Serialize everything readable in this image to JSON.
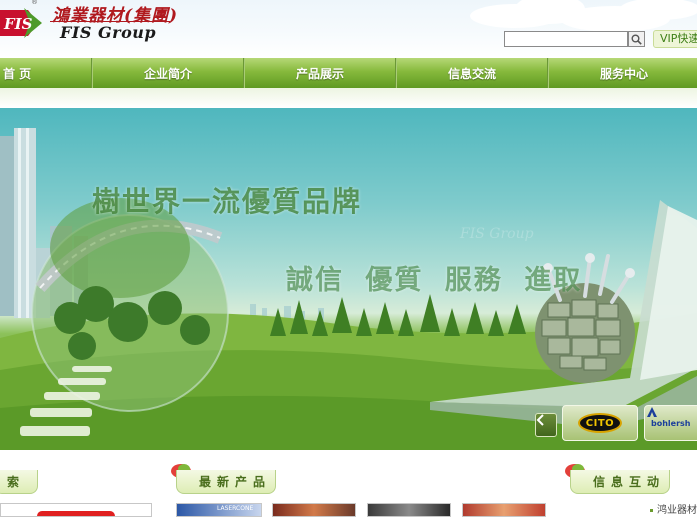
{
  "header": {
    "logo_mark_text": "FIS",
    "logo_reg": "®",
    "logo_cn": "鴻業器材(集團)",
    "logo_en": "FIS Group",
    "search": {
      "value": "",
      "placeholder": "",
      "button_icon": "search-icon"
    },
    "vip_link": "VIP快速"
  },
  "nav": {
    "items": [
      {
        "label": "首 页"
      },
      {
        "label": "企业简介"
      },
      {
        "label": "产品展示"
      },
      {
        "label": "信息交流"
      },
      {
        "label": "服务中心"
      }
    ]
  },
  "banner": {
    "slogan_1": "樹世界一流優質品牌",
    "slogan_2": "誠信 優質 服務 進取",
    "ghost_brand": "FIS Group",
    "prev_icon": "chevron-left-icon",
    "brands": [
      {
        "name": "CITO",
        "reg": "®"
      },
      {
        "name": "bohlersh"
      }
    ]
  },
  "sections": {
    "search_tab": "索",
    "products_tab": "最新产品",
    "interaction_tab": "信息互动",
    "news_first": "鸿业器材"
  },
  "thumbnails": [
    {
      "label": "LASERCONE"
    }
  ],
  "colors": {
    "nav_green": "#86b93c",
    "logo_red": "#b0191e",
    "accent_green": "#4a6e1d"
  }
}
